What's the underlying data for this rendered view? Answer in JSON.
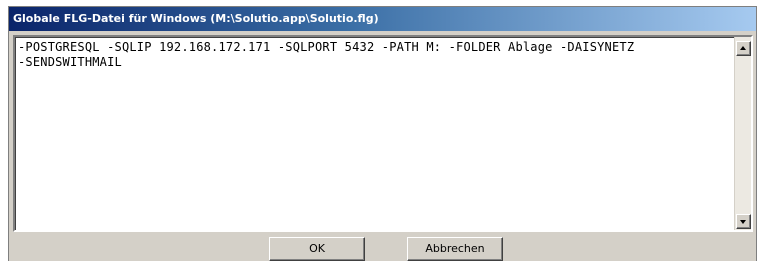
{
  "window": {
    "title": "Globale FLG-Datei für Windows (M:\\Solutio.app\\Solutio.flg)"
  },
  "editor": {
    "content": "-POSTGRESQL -SQLIP 192.168.172.171 -SQLPORT 5432 -PATH M: -FOLDER Ablage -DAISYNETZ\n-SENDSWITHMAIL"
  },
  "buttons": {
    "ok_label": "OK",
    "cancel_label": "Abbrechen"
  },
  "icons": {
    "scroll_up": "scroll-up-arrow-icon",
    "scroll_down": "scroll-down-arrow-icon"
  },
  "colors": {
    "titlebar_start": "#0a246a",
    "titlebar_end": "#a6caf0",
    "face": "#d4d0c8"
  }
}
